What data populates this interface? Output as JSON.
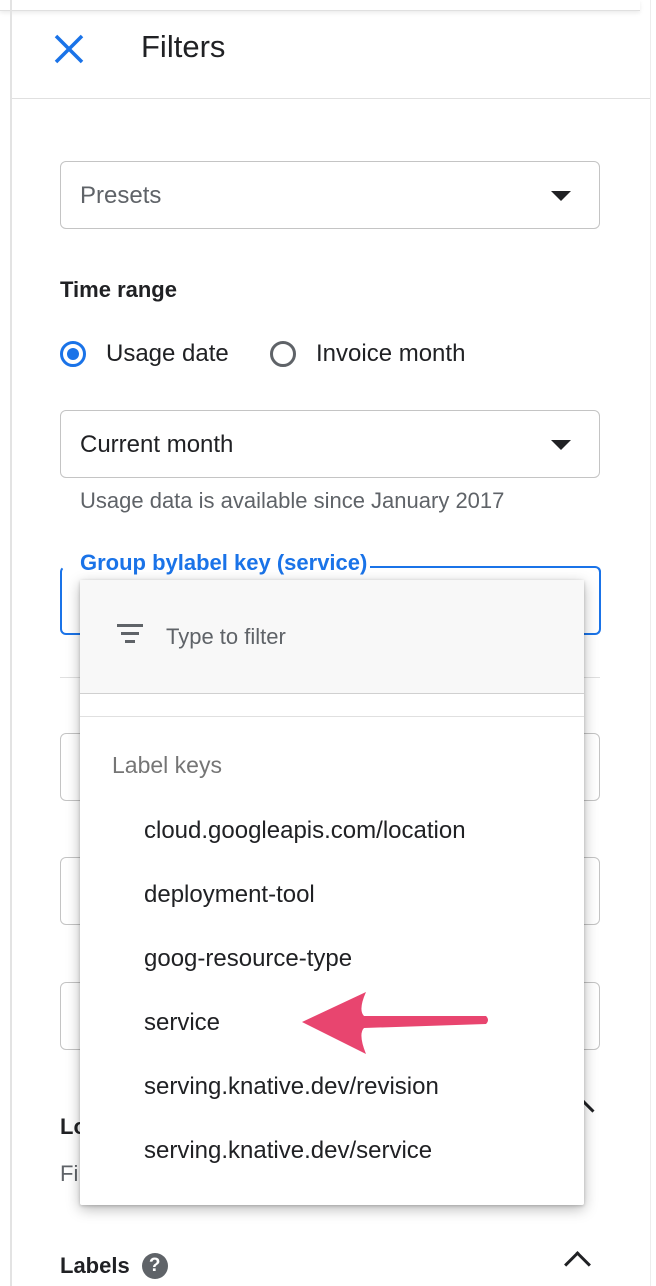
{
  "panel": {
    "title": "Filters",
    "close_icon": "close-icon"
  },
  "presets": {
    "value": "Presets"
  },
  "time_range": {
    "label": "Time range",
    "options": [
      {
        "label": "Usage date",
        "selected": true
      },
      {
        "label": "Invoice month",
        "selected": false
      }
    ],
    "range_value": "Current month",
    "hint": "Usage data is available since January 2017"
  },
  "group_by": {
    "label": "Group bylabel key (service)"
  },
  "dropdown": {
    "filter_placeholder": "Type to filter",
    "group_heading": "Label keys",
    "items": [
      "cloud.googleapis.com/location",
      "deployment-tool",
      "goog-resource-type",
      "service",
      "serving.knative.dev/revision",
      "serving.knative.dev/service"
    ]
  },
  "obscured": {
    "location_label_fragment": "Lo",
    "location_sub_fragment": "Fi"
  },
  "labels_section": {
    "label": "Labels",
    "help_icon": "help-icon",
    "help_glyph": "?"
  },
  "colors": {
    "accent": "#1a73e8",
    "arrow": "#e8456f"
  }
}
